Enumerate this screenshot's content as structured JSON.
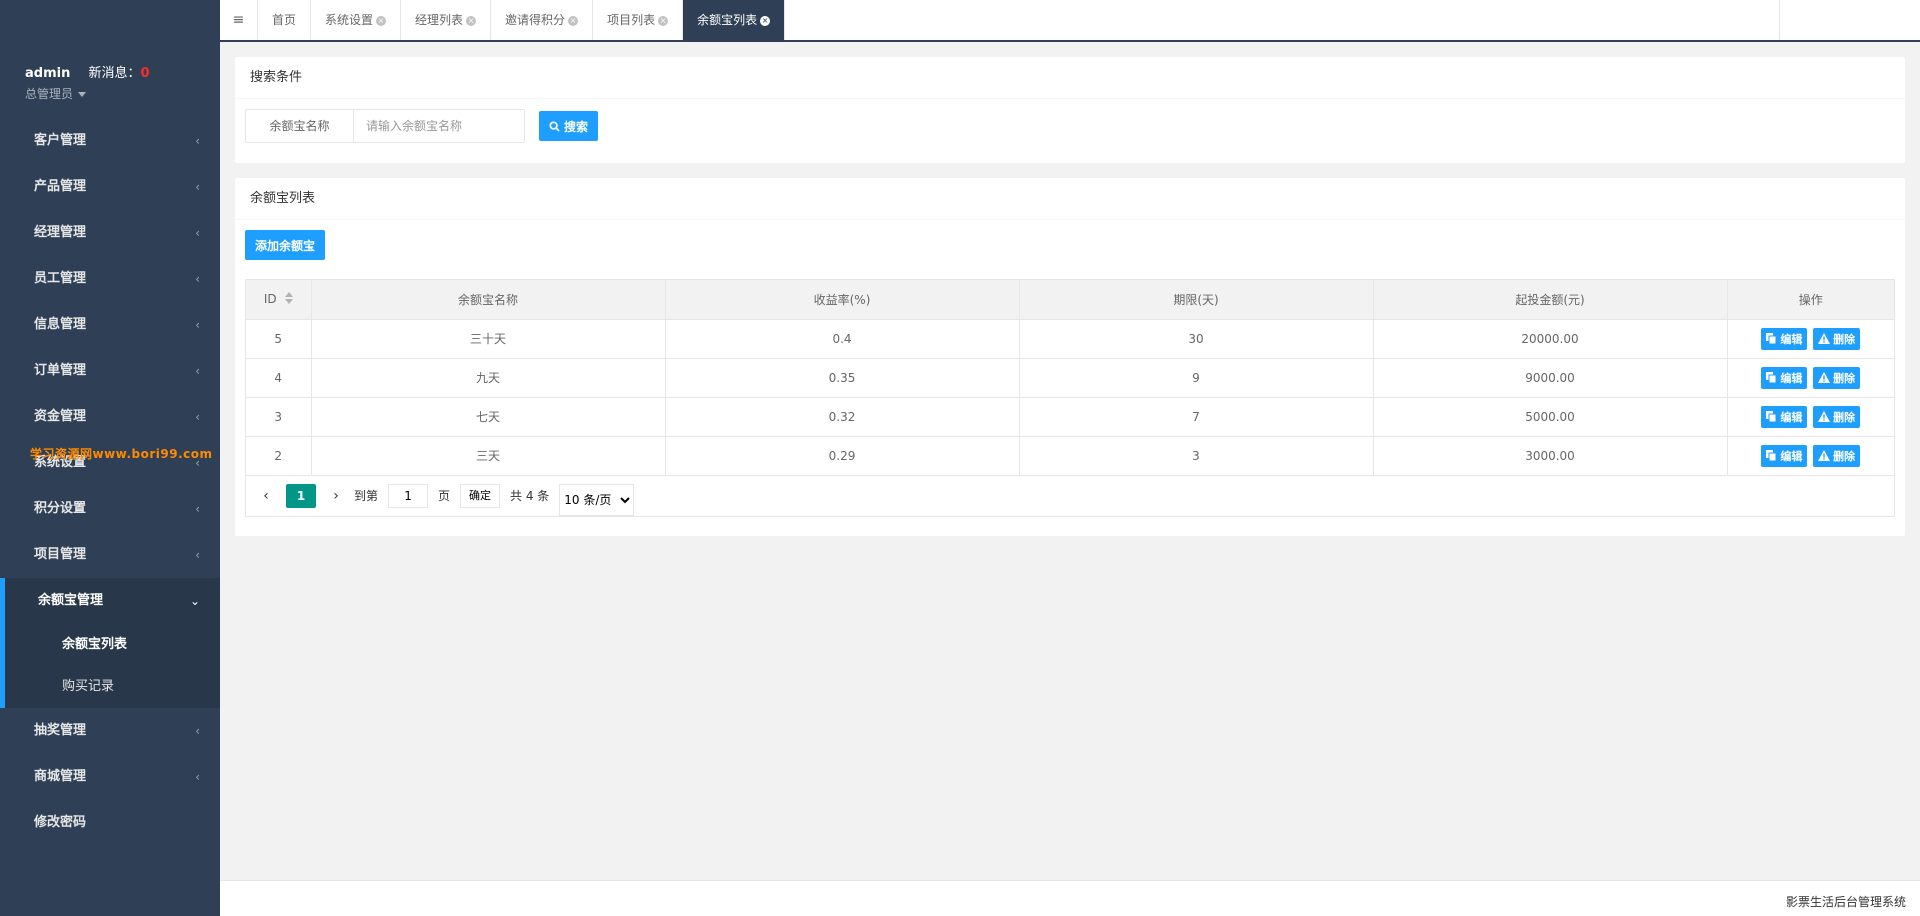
{
  "user": {
    "name": "admin",
    "msg_label": "新消息：",
    "msg_count": "0",
    "role": "总管理员"
  },
  "watermark": "学习资源网www.bori99.com",
  "nav": {
    "items_top": [
      {
        "label": "客户管理"
      },
      {
        "label": "产品管理"
      },
      {
        "label": "经理管理"
      },
      {
        "label": "员工管理"
      },
      {
        "label": "信息管理"
      },
      {
        "label": "订单管理"
      },
      {
        "label": "资金管理"
      },
      {
        "label": "系统设置"
      },
      {
        "label": "积分设置"
      },
      {
        "label": "项目管理"
      }
    ],
    "active_group": {
      "label": "余额宝管理",
      "subs": [
        {
          "label": "余额宝列表"
        },
        {
          "label": "购买记录"
        }
      ]
    },
    "items_bottom": [
      {
        "label": "抽奖管理"
      },
      {
        "label": "商城管理"
      },
      {
        "label": "修改密码"
      }
    ]
  },
  "tabs": [
    {
      "label": "首页"
    },
    {
      "label": "系统设置"
    },
    {
      "label": "经理列表"
    },
    {
      "label": "邀请得积分"
    },
    {
      "label": "项目列表"
    },
    {
      "label": "余额宝列表"
    }
  ],
  "search": {
    "title": "搜索条件",
    "field_label": "余额宝名称",
    "placeholder": "请输入余额宝名称",
    "button": "搜索"
  },
  "list": {
    "title": "余额宝列表",
    "add_button": "添加余额宝",
    "columns": [
      "ID",
      "余额宝名称",
      "收益率(%)",
      "期限(天)",
      "起投金额(元)",
      "操作"
    ],
    "rows": [
      {
        "id": "5",
        "name": "三十天",
        "rate": "0.4",
        "days": "30",
        "min": "20000.00"
      },
      {
        "id": "4",
        "name": "九天",
        "rate": "0.35",
        "days": "9",
        "min": "9000.00"
      },
      {
        "id": "3",
        "name": "七天",
        "rate": "0.32",
        "days": "7",
        "min": "5000.00"
      },
      {
        "id": "2",
        "name": "三天",
        "rate": "0.29",
        "days": "3",
        "min": "3000.00"
      }
    ],
    "edit_label": "编辑",
    "delete_label": "删除"
  },
  "pager": {
    "current": "1",
    "goto_label": "到第",
    "goto_value": "1",
    "page_label": "页",
    "confirm": "确定",
    "total": "共 4 条",
    "page_size": "10 条/页"
  },
  "footer": "影票生活后台管理系统",
  "colors": {
    "sidebar": "#2f4056",
    "accent": "#1e9fff",
    "pager_active": "#009688",
    "msg_count": "#ff2a2a"
  }
}
